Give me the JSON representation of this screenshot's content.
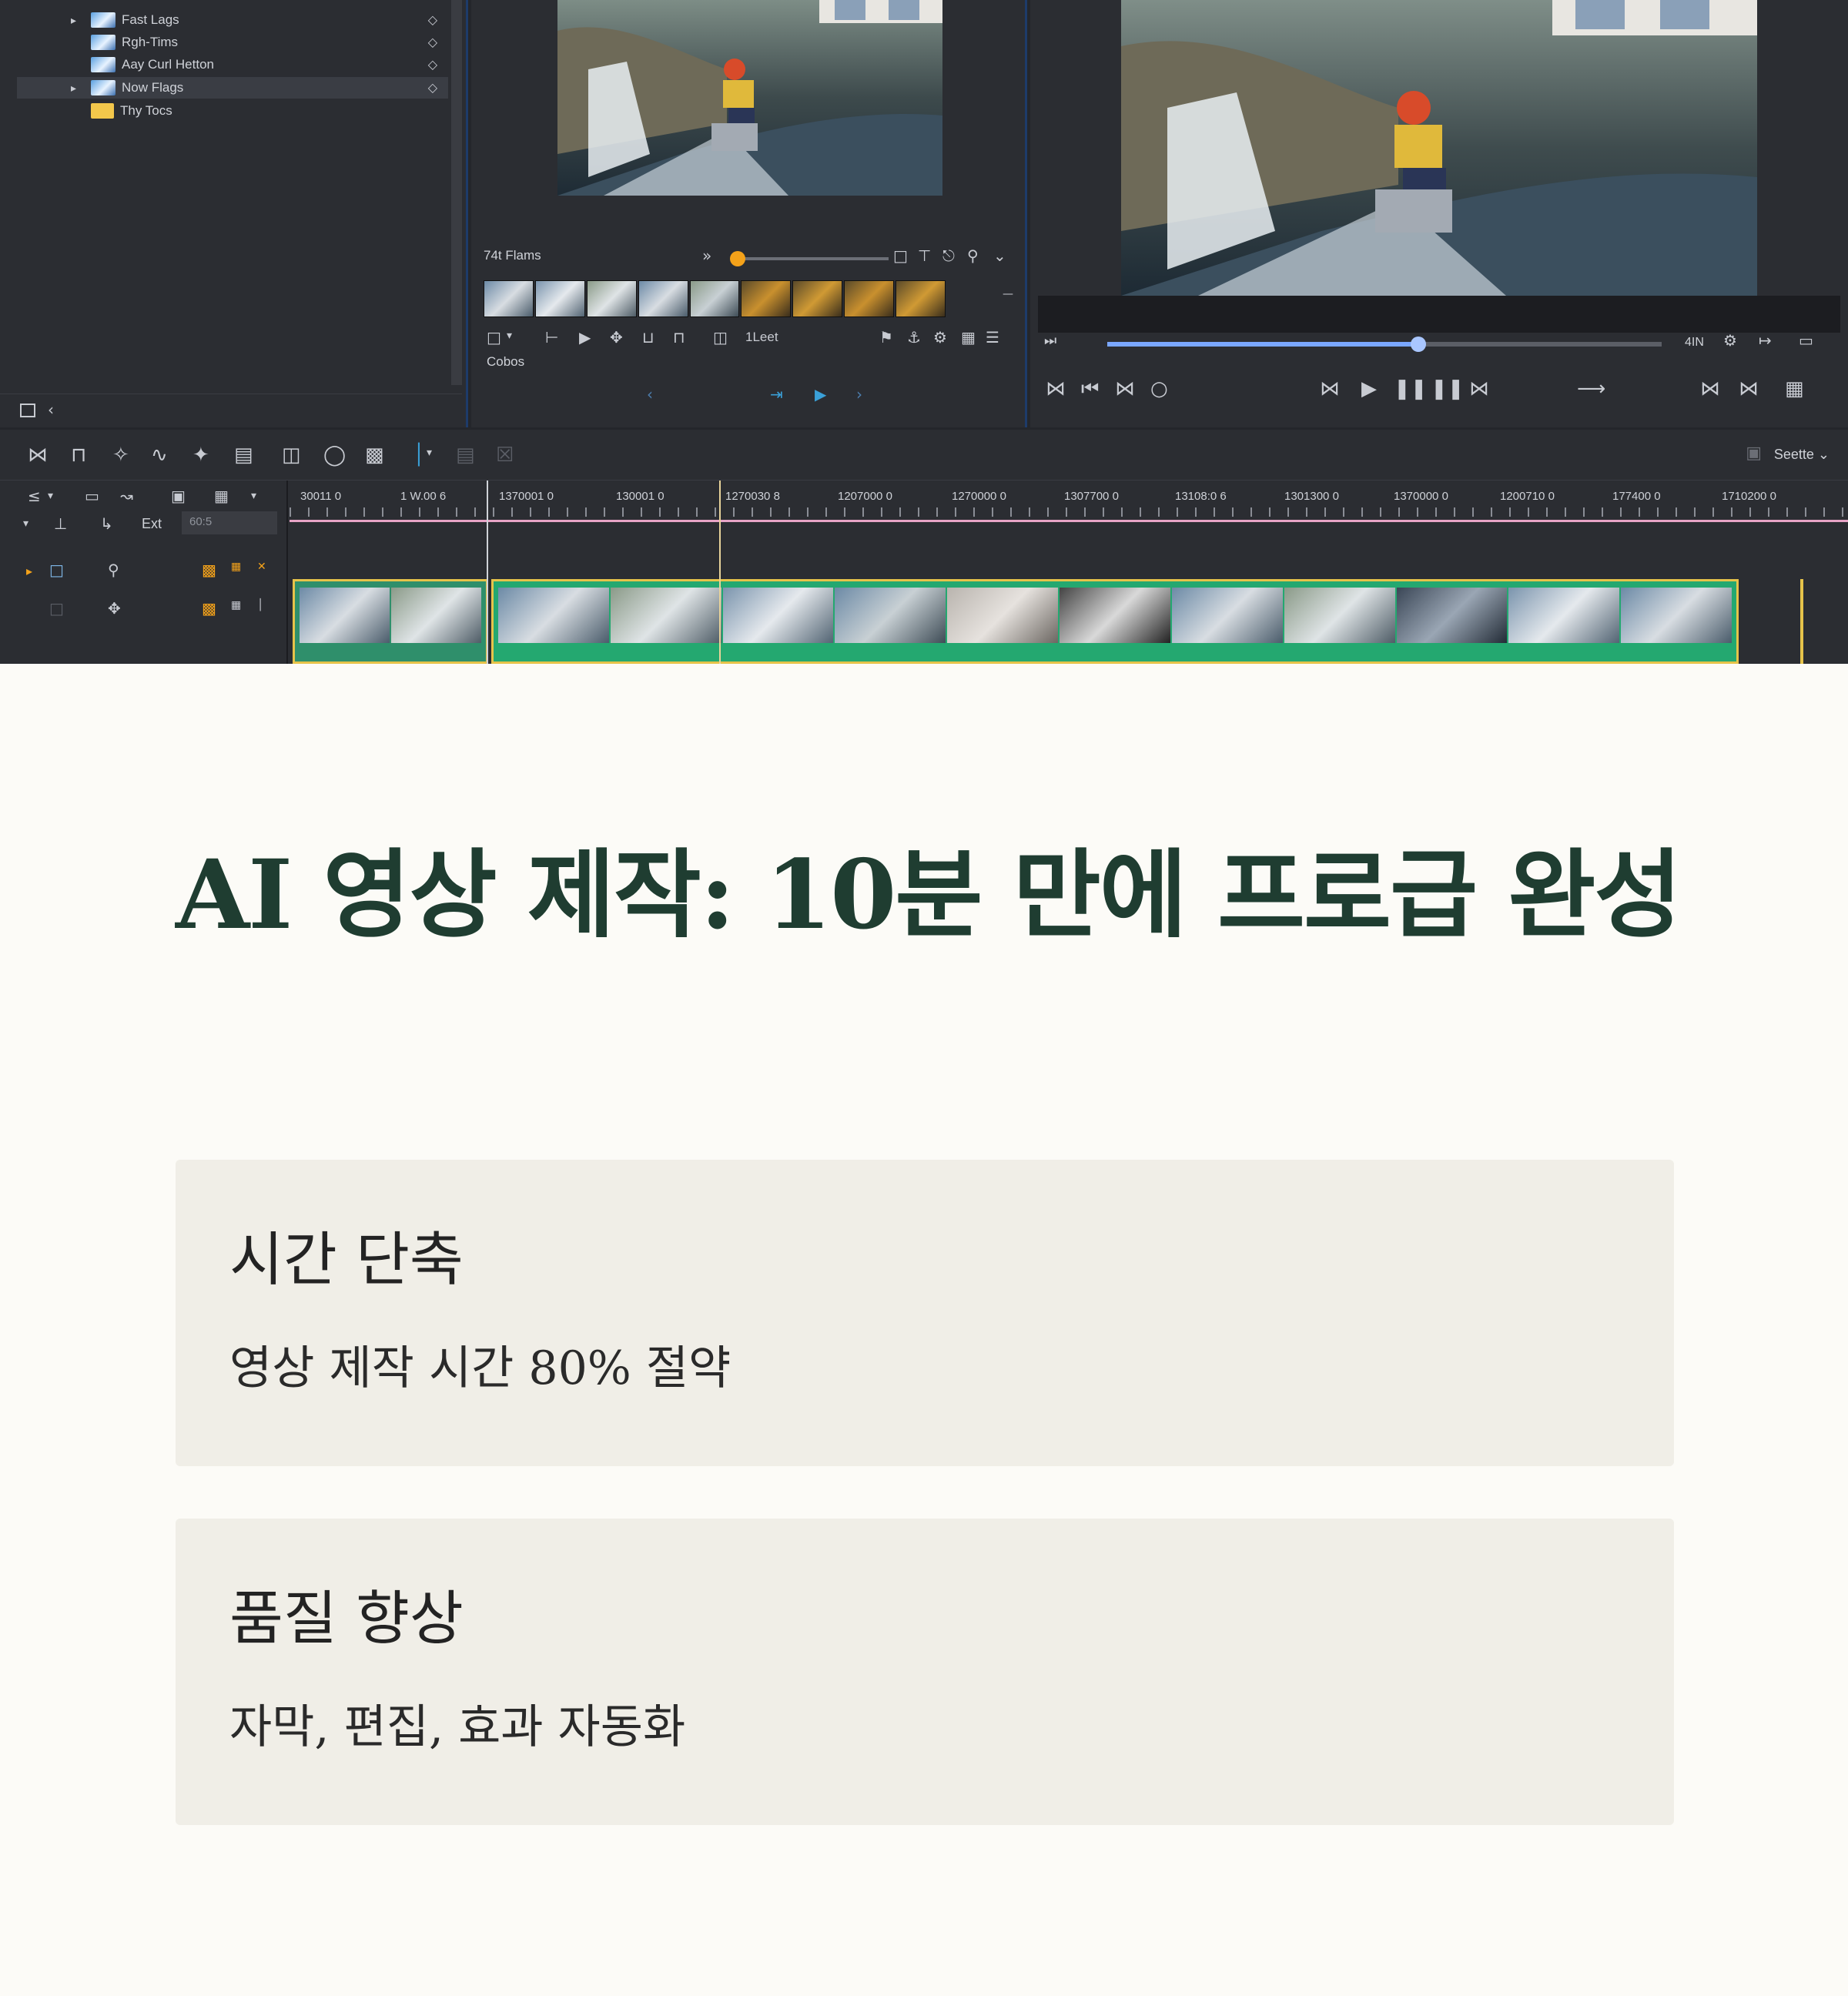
{
  "editor": {
    "project_items": [
      {
        "label": "Fast Lags",
        "expanded": true,
        "type": "clip"
      },
      {
        "label": "Rgh-Tims",
        "expanded": false,
        "type": "clip"
      },
      {
        "label": "Aay Curl Hetton",
        "expanded": false,
        "type": "clip"
      },
      {
        "label": "Now Flags",
        "expanded": true,
        "type": "clip",
        "selected": true
      },
      {
        "label": "Thy Tocs",
        "expanded": false,
        "type": "folder"
      }
    ],
    "source": {
      "label": "74t Flams",
      "tool_label": "1Leet",
      "sub_label": "Cobos"
    },
    "program": {
      "zoom_label": "4IN"
    },
    "timeline": {
      "scene_button": "Seette",
      "ext_label": "Ext",
      "ext_field": "60:5",
      "ruler_labels": [
        "30011 0",
        "1 W.00 6",
        "1370001 0",
        "130001 0",
        "1270030 8",
        "1207000 0",
        "1270000 0",
        "1307700 0",
        "13108:0 6",
        "1301300 0",
        "1370000 0",
        "1200710 0",
        "177400 0",
        "1710200 0"
      ]
    },
    "colors": {
      "accent": "#f4a21a",
      "clip_green": "#24a870",
      "clip_border": "#e6c34a",
      "panel_border": "#1d3b6a"
    }
  },
  "headline": "AI 영상 제작: 10분 만에 프로급 완성",
  "cards": [
    {
      "title": "시간 단축",
      "body": "영상 제작 시간 80% 절약"
    },
    {
      "title": "품질 향상",
      "body": "자막, 편집, 효과 자동화"
    }
  ]
}
